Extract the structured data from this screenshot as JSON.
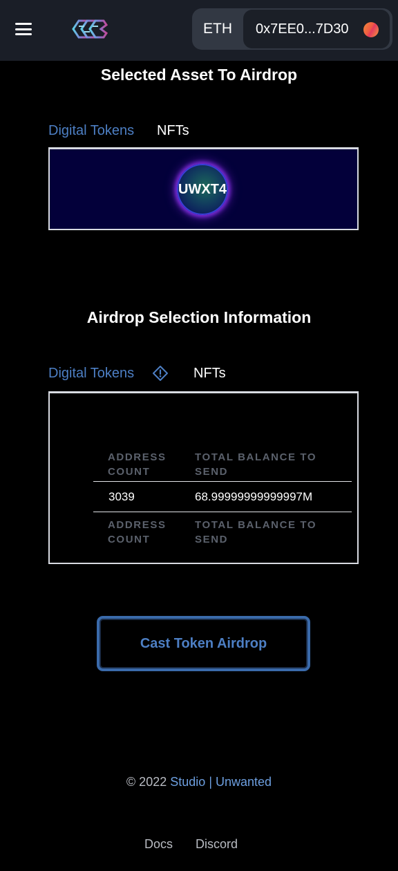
{
  "header": {
    "network": "ETH",
    "account_address": "0x7EE0...7D30"
  },
  "selected_asset": {
    "title": "Selected Asset To Airdrop",
    "tabs": [
      "Digital Tokens",
      "NFTs"
    ],
    "token_symbol": "UWXT4"
  },
  "airdrop_info": {
    "title": "Airdrop Selection Information",
    "tabs": [
      "Digital Tokens",
      "NFTs"
    ],
    "table": {
      "headers": [
        [
          "ADDRESS",
          "COUNT"
        ],
        [
          "TOTAL BALANCE TO",
          "SEND"
        ]
      ],
      "rows": [
        [
          "3039",
          "68.99999999999997M"
        ]
      ],
      "footers": [
        [
          "ADDRESS",
          "COUNT"
        ],
        [
          "TOTAL BALANCE TO",
          "SEND"
        ]
      ]
    }
  },
  "actions": {
    "cast_airdrop_label": "Cast Token Airdrop"
  },
  "footer": {
    "copyright_prefix": "© 2022",
    "studio_label": "Studio",
    "separator": "|",
    "unwanted_label": "Unwanted",
    "links": [
      "Docs",
      "Discord"
    ]
  },
  "colors": {
    "accent": "#4d7fc4",
    "header_bg": "#1a1e27",
    "asset_box_bg": "#03003a",
    "button_border": "#3a6aaa"
  },
  "icons": {
    "menu": "hamburger-menu-icon",
    "logo": "brand-logo",
    "info": "info-diamond-icon"
  }
}
